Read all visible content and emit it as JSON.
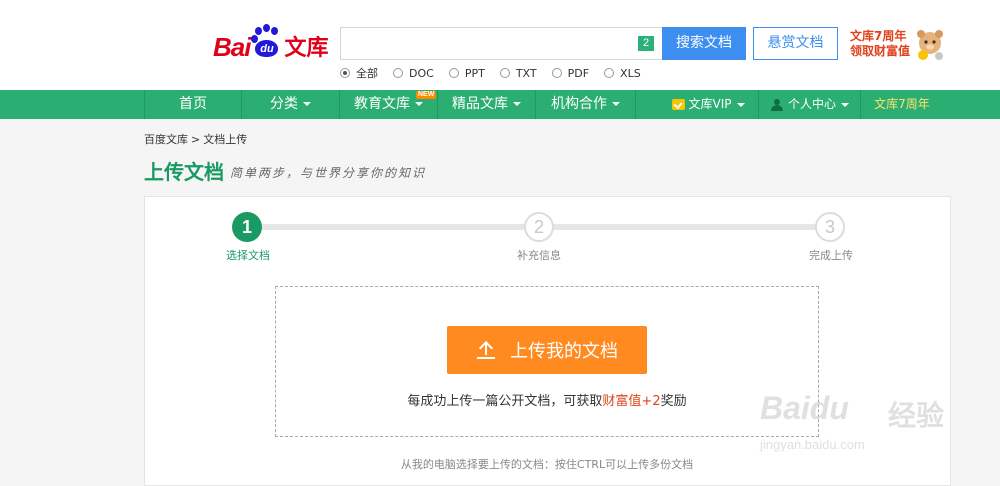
{
  "header": {
    "logo_bai": "Bai",
    "logo_du": "du",
    "logo_wenku": "文库",
    "search_placeholder": "",
    "search_badge": "2",
    "search_button": "搜索文档",
    "reward_button": "悬赏文档",
    "promo_line1": "文库7周年",
    "promo_line2": "领取财富值"
  },
  "filetypes": [
    {
      "label": "全部",
      "selected": true
    },
    {
      "label": "DOC",
      "selected": false
    },
    {
      "label": "PPT",
      "selected": false
    },
    {
      "label": "TXT",
      "selected": false
    },
    {
      "label": "PDF",
      "selected": false
    },
    {
      "label": "XLS",
      "selected": false
    }
  ],
  "nav": {
    "home": "首页",
    "category": "分类",
    "education": "教育文库",
    "new_badge": "NEW",
    "premium": "精品文库",
    "partners": "机构合作",
    "vip": "文库VIP",
    "personal": "个人中心",
    "anniversary": "文库7周年"
  },
  "breadcrumb": {
    "root": "百度文库",
    "sep": ">",
    "current": "文档上传"
  },
  "page": {
    "title": "上传文档",
    "slogan": "简单两步，与世界分享你的知识"
  },
  "steps": [
    {
      "number": "1",
      "label": "选择文档",
      "active": true
    },
    {
      "number": "2",
      "label": "补充信息",
      "active": false
    },
    {
      "number": "3",
      "label": "完成上传",
      "active": false
    }
  ],
  "upload": {
    "button_label": "上传我的文档",
    "hint_prefix": "每成功上传一篇公开文档，可获取",
    "hint_highlight": "财富值",
    "hint_bonus": "+2",
    "hint_suffix": "奖励",
    "sub_hint": "从我的电脑选择要上传的文档：按住CTRL可以上传多份文档"
  },
  "watermark": {
    "bai": "Bai",
    "du": "du",
    "jingyan": "经验",
    "url": "jingyan.baidu.com"
  },
  "colors": {
    "brand_green": "#2bae72",
    "title_green": "#1a9a63",
    "search_blue": "#3c8ef0",
    "upload_orange": "#ff8a1f",
    "logo_red": "#e1001a",
    "logo_blue": "#2319dc"
  }
}
